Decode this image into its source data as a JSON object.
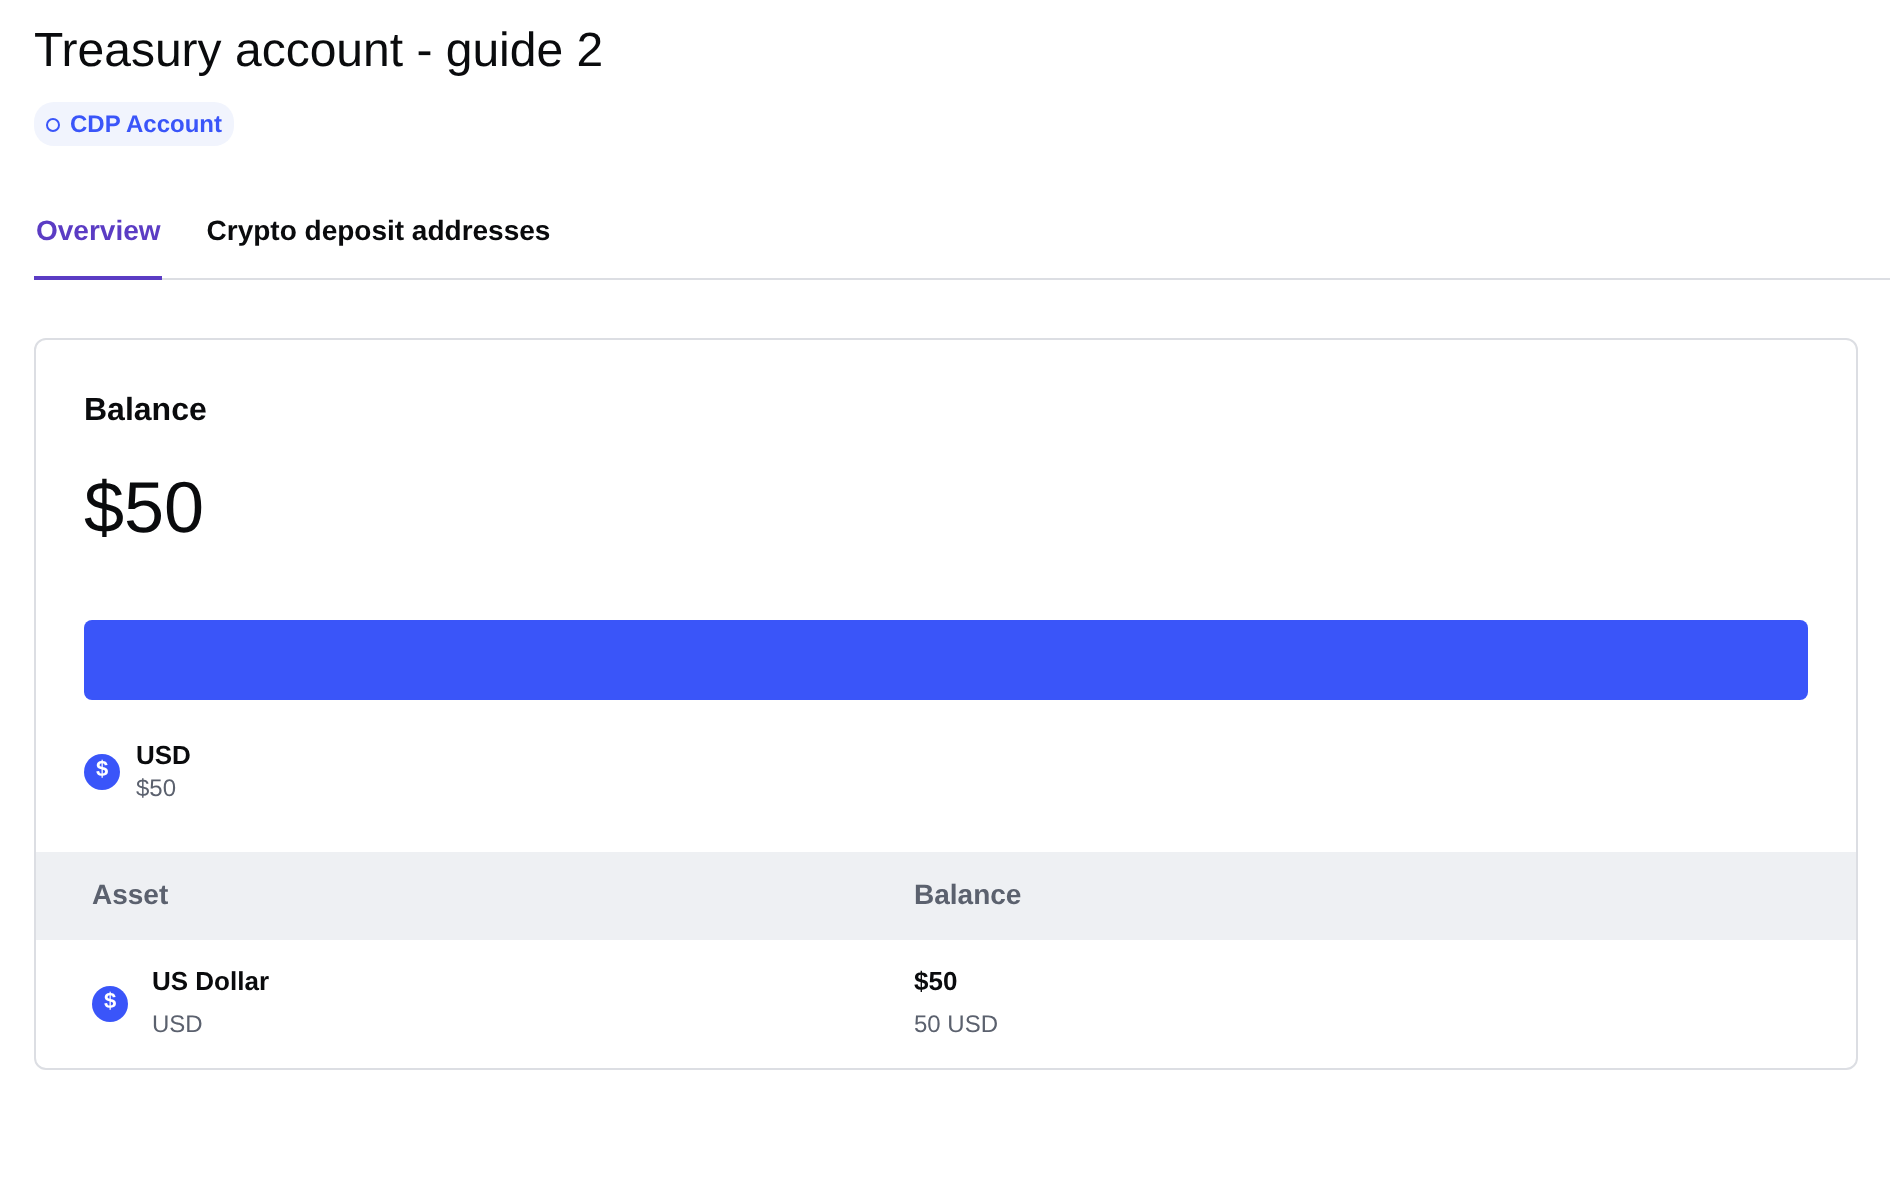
{
  "title": "Treasury account - guide 2",
  "badge": "CDP Account",
  "tabs": [
    {
      "label": "Overview",
      "selected": true
    },
    {
      "label": "Crypto deposit addresses",
      "selected": false
    }
  ],
  "balance": {
    "label": "Balance",
    "amount": "$50",
    "allocation": [
      {
        "glyph": "$",
        "name": "USD",
        "amount": "$50",
        "color": "#3a55f9"
      }
    ]
  },
  "table": {
    "columns": [
      "Asset",
      "Balance"
    ],
    "rows": [
      {
        "glyph": "$",
        "name": "US Dollar",
        "code": "USD",
        "balance": "$50",
        "units": "50 USD"
      }
    ]
  }
}
